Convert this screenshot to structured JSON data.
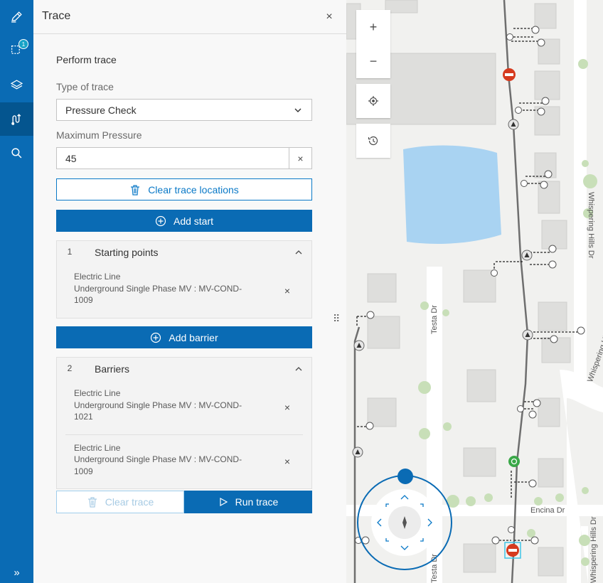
{
  "rail": {
    "badge_count": "1",
    "expand_glyph": "»",
    "items": [
      {
        "icon": "pencil-icon"
      },
      {
        "icon": "select-icon"
      },
      {
        "icon": "layers-icon"
      },
      {
        "icon": "trace-icon"
      },
      {
        "icon": "search-icon"
      }
    ]
  },
  "panel": {
    "title": "Trace",
    "close_glyph": "×",
    "section_title": "Perform trace",
    "trace_type_label": "Type of trace",
    "trace_type_value": "Pressure Check",
    "max_pressure_label": "Maximum Pressure",
    "max_pressure_value": "45",
    "clear_glyph": "×",
    "clear_locations_label": "Clear trace locations",
    "add_start_label": "Add start",
    "starting_points": {
      "number": "1",
      "title": "Starting points",
      "items": [
        {
          "line1": "Electric Line",
          "line2": "Underground Single Phase MV : MV-COND-1009"
        }
      ]
    },
    "add_barrier_label": "Add barrier",
    "barriers": {
      "number": "2",
      "title": "Barriers",
      "items": [
        {
          "line1": "Electric Line",
          "line2": "Underground Single Phase MV : MV-COND-1021"
        },
        {
          "line1": "Electric Line",
          "line2": "Underground Single Phase MV : MV-COND-1009"
        }
      ]
    },
    "clear_trace_label": "Clear trace",
    "run_trace_label": "Run trace"
  },
  "map": {
    "controls": {
      "zoom_in": "+",
      "zoom_out": "−"
    },
    "streets": {
      "testa_1": "Testa Dr",
      "testa_2": "Testa Dr",
      "whispering_1": "Whispering Hills Dr",
      "whispering_2": "Whispering Hills Dr",
      "whispering_3": "Whispering Hills Dr",
      "encina": "Encina Dr"
    }
  },
  "colors": {
    "rail": "#0a6bb4",
    "accent": "#0a79c7",
    "water": "#a9d3f2",
    "barrier": "#d63a1e",
    "start": "#3aa848"
  }
}
